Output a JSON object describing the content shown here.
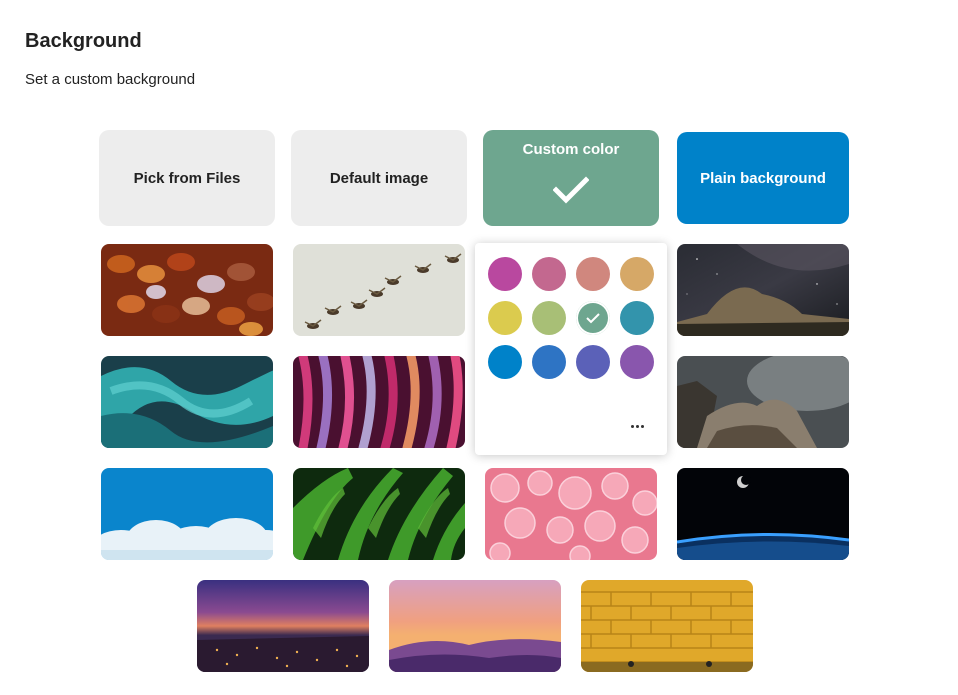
{
  "header": {
    "title": "Background",
    "subtitle": "Set a custom background"
  },
  "options": {
    "pick_files": "Pick from Files",
    "default_image": "Default image",
    "custom_color": "Custom color",
    "plain_background": "Plain background"
  },
  "colors": {
    "custom_selected": "#6ea68f",
    "plain": "#0082c9",
    "tile_bg": "#ededed"
  },
  "palette": [
    "#b9489f",
    "#c3688f",
    "#d0877e",
    "#d6a867",
    "#dbcb4e",
    "#a8bf76",
    "#6ea68f",
    "#3394ac",
    "#0082c9",
    "#2e74c4",
    "#5b61b8",
    "#8956ad"
  ],
  "palette_selected_index": 6,
  "images": [
    "butterfly-wing-scales",
    "flying-birds",
    "milky-way-night-sky",
    "teal-ink-swirl",
    "pink-purple-fabric",
    "stormy-rocky-coast",
    "clouds-blue-sky",
    "green-fern-leaves",
    "pink-bubbles",
    "earth-from-space",
    "city-lights-dusk",
    "purple-mountain-sunset",
    "yellow-brick-wall"
  ]
}
